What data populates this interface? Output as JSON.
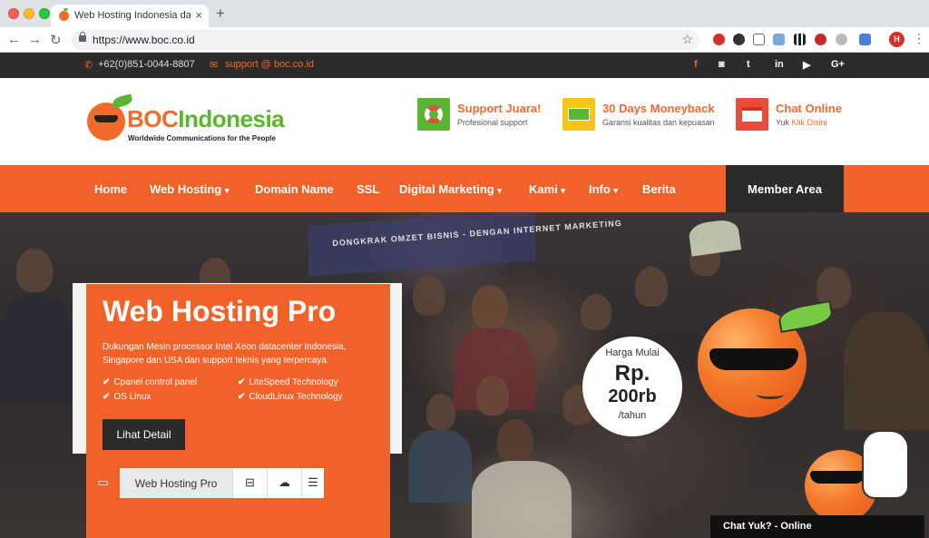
{
  "browser": {
    "tab_title": "Web Hosting Indonesia dan D",
    "tab_close": "×",
    "new_tab": "+",
    "url": "https://www.boc.co.id",
    "profile_initial": "H",
    "back": "←",
    "forward": "→",
    "reload": "↻",
    "star": "☆",
    "menu": "⋮"
  },
  "topbar": {
    "phone_icon": "phone-icon",
    "phone": "+62(0)851-0044-8807",
    "email_icon": "mail-icon",
    "email": "support @ boc.co.id",
    "social": [
      "f",
      "◙",
      "t",
      "in",
      "▶",
      "G+"
    ]
  },
  "logo": {
    "brand_boc": "BOC",
    "brand_indonesia": "Indonesia",
    "tagline": "Worldwide Communications for the People"
  },
  "features": [
    {
      "title": "Support Juara!",
      "subtitle": "Profesional support",
      "color": "#5ab52f"
    },
    {
      "title": "30 Days Moneyback",
      "subtitle": "Garansi kualitas dan kepuasan",
      "color": "#f5c518"
    },
    {
      "title": "Chat Online",
      "subtitle_prefix": "Yuk ",
      "subtitle_link": "Klik Disini",
      "color": "#e94b3c"
    }
  ],
  "nav": {
    "items": [
      "Home",
      "Web Hosting",
      "Domain Name",
      "SSL",
      "Digital Marketing",
      "Kami",
      "Info",
      "Berita"
    ],
    "caret": "▾",
    "member": "Member Area"
  },
  "hero": {
    "banner": "DONGKRAK OMZET BISNIS - DENGAN INTERNET MARKETING",
    "promo_title": "Web Hosting Pro",
    "promo_desc": "Dukungan Mesin processor Intel Xeon datacenter Indonesia, Singapore dan USA dan support teknis yang terpercaya.",
    "features_left": [
      "Cpanel control panel",
      "OS Linux"
    ],
    "features_right": [
      "LiteSpeed Technology",
      "CloudLinux Technology"
    ],
    "check": "✔",
    "detail_button": "Lihat Detail",
    "tab_label": "Web Hosting Pro",
    "price_label": "Harga Mulai",
    "price_currency": "Rp.",
    "price_value": "200rb",
    "price_unit": "/tahun",
    "chat": "Chat Yuk? - Online"
  },
  "colors": {
    "accent": "#f1622a",
    "dark": "#2b2b2b",
    "brand_green": "#5ab52f"
  }
}
